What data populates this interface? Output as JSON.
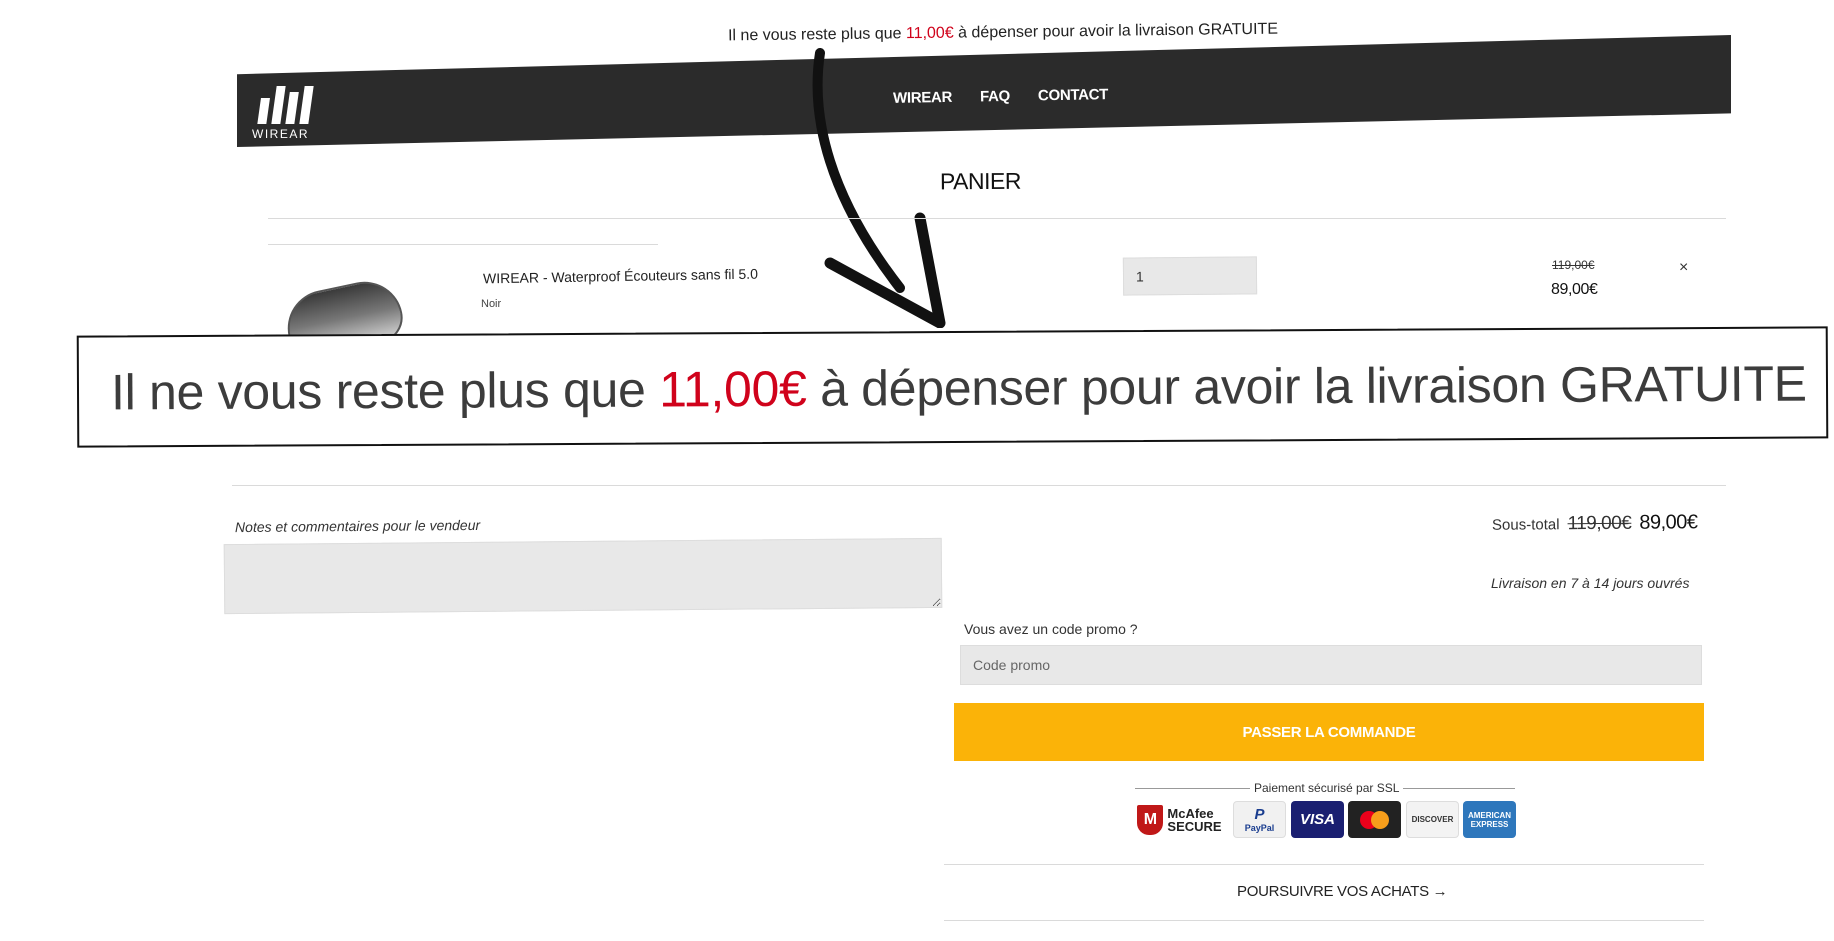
{
  "shipping_banner": {
    "prefix": "Il ne vous reste plus que",
    "amount": "11,00€",
    "suffix": "à dépenser pour avoir la livraison GRATUITE"
  },
  "brand": {
    "name": "WIREAR"
  },
  "nav": {
    "items": [
      "WIREAR",
      "FAQ",
      "CONTACT"
    ]
  },
  "page": {
    "title": "PANIER"
  },
  "cart": {
    "item": {
      "name": "WIREAR - Waterproof Écouteurs sans fil 5.0",
      "variant": "Noir",
      "quantity": "1",
      "old_price": "119,00€",
      "price": "89,00€",
      "remove_symbol": "×"
    }
  },
  "notes": {
    "label": "Notes et commentaires pour le vendeur",
    "value": ""
  },
  "summary": {
    "subtotal_label": "Sous-total",
    "subtotal_old": "119,00€",
    "subtotal_new": "89,00€",
    "delivery": "Livraison en 7 à 14 jours ouvrés"
  },
  "promo": {
    "label": "Vous avez un code promo ?",
    "placeholder": "Code promo",
    "value": ""
  },
  "checkout": {
    "label": "PASSER LA COMMANDE"
  },
  "payment": {
    "ssl_label": "Paiement sécurisé par SSL",
    "badges": {
      "mcafee_1": "McAfee",
      "mcafee_2": "SECURE",
      "paypal_1": "P",
      "paypal_2": "PayPal",
      "visa": "VISA",
      "discover": "DISCOVER",
      "amex_1": "AMERICAN",
      "amex_2": "EXPRESS"
    }
  },
  "continue_link": {
    "label": "POURSUIVRE VOS ACHATS →"
  },
  "colors": {
    "header_bg": "#2b2b2b",
    "accent": "#fbb308",
    "price_red": "#d0021b"
  }
}
